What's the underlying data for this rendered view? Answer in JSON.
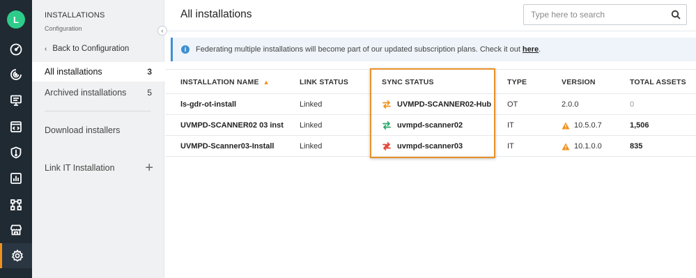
{
  "user": {
    "avatar_initial": "L",
    "avatar_color": "#2ecc8a"
  },
  "rail": {
    "items": [
      {
        "icon": "dashboard-gauge-icon"
      },
      {
        "icon": "radar-icon"
      },
      {
        "icon": "monitor-icon"
      },
      {
        "icon": "code-window-icon"
      },
      {
        "icon": "shield-alert-icon"
      },
      {
        "icon": "report-chart-icon"
      },
      {
        "icon": "network-icon"
      },
      {
        "icon": "store-icon"
      },
      {
        "icon": "settings-gear-icon",
        "active": true
      }
    ]
  },
  "sidebar": {
    "title": "INSTALLATIONS",
    "subtitle": "Configuration",
    "back_label": "Back to Configuration",
    "items": [
      {
        "label": "All installations",
        "count": "3",
        "active": true
      },
      {
        "label": "Archived installations",
        "count": "5",
        "active": false
      }
    ],
    "download_label": "Download installers",
    "link_it_label": "Link IT Installation"
  },
  "header": {
    "title": "All installations",
    "search_placeholder": "Type here to search"
  },
  "banner": {
    "text": "Federating multiple installations will become part of our updated subscription plans. Check it out",
    "link_text": "here",
    "suffix": "."
  },
  "table": {
    "columns": {
      "name": "INSTALLATION NAME",
      "link_status": "LINK STATUS",
      "sync_status": "SYNC STATUS",
      "type": "TYPE",
      "version": "VERSION",
      "total_assets": "TOTAL ASSETS"
    },
    "rows": [
      {
        "name": "ls-gdr-ot-install",
        "link_status": "Linked",
        "sync": "UVMPD-SCANNER02-Hub",
        "sync_icon": "sync-hub-icon",
        "type": "OT",
        "version": "2.0.0",
        "version_warning": false,
        "total_assets": "0"
      },
      {
        "name": "UVMPD-SCANNER02 03 inst",
        "link_status": "Linked",
        "sync": "uvmpd-scanner02",
        "sync_icon": "sync-ok-icon",
        "type": "IT",
        "version": "10.5.0.7",
        "version_warning": true,
        "total_assets": "1,506"
      },
      {
        "name": "UVMPD-Scanner03-Install",
        "link_status": "Linked",
        "sync": "uvmpd-scanner03",
        "sync_icon": "sync-error-icon",
        "type": "IT",
        "version": "10.1.0.0",
        "version_warning": true,
        "total_assets": "835"
      }
    ]
  },
  "colors": {
    "accent": "#f0921e",
    "sync_hub": "#f0921e",
    "sync_ok": "#2aa86a",
    "sync_error": "#e24a3b",
    "info": "#3f8fd1",
    "highlight_box": "#e8912a"
  }
}
